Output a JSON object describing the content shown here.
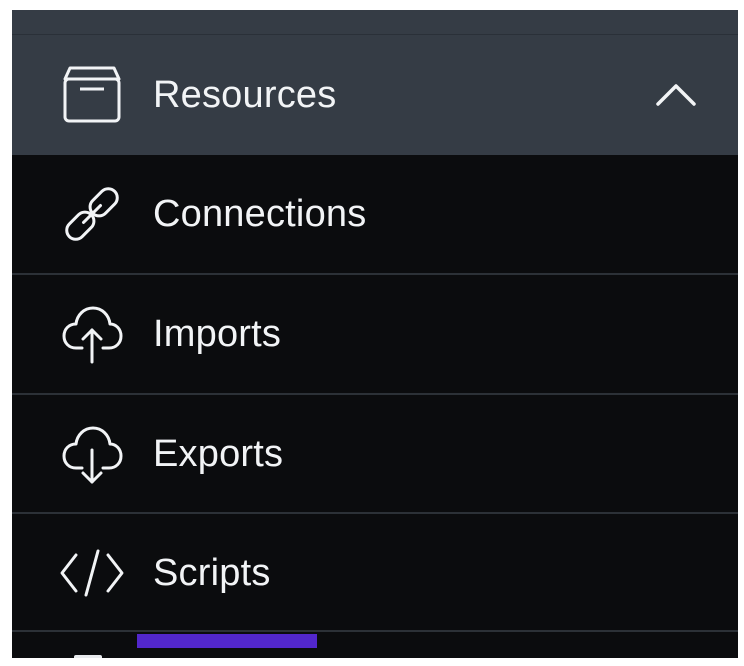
{
  "nav": {
    "group": {
      "label": "Resources",
      "icon": "box-icon",
      "expanded": true,
      "toggle_icon": "chevron-up-icon"
    },
    "items": [
      {
        "label": "Connections",
        "icon": "link-icon"
      },
      {
        "label": "Imports",
        "icon": "cloud-upload-icon"
      },
      {
        "label": "Exports",
        "icon": "cloud-download-icon"
      },
      {
        "label": "Scripts",
        "icon": "code-icon"
      }
    ]
  },
  "colors": {
    "header_bg": "#353c45",
    "menu_bg": "#0b0c0e",
    "divider": "#2c3137",
    "text": "#f2f4f6",
    "accent": "#5227cc"
  }
}
